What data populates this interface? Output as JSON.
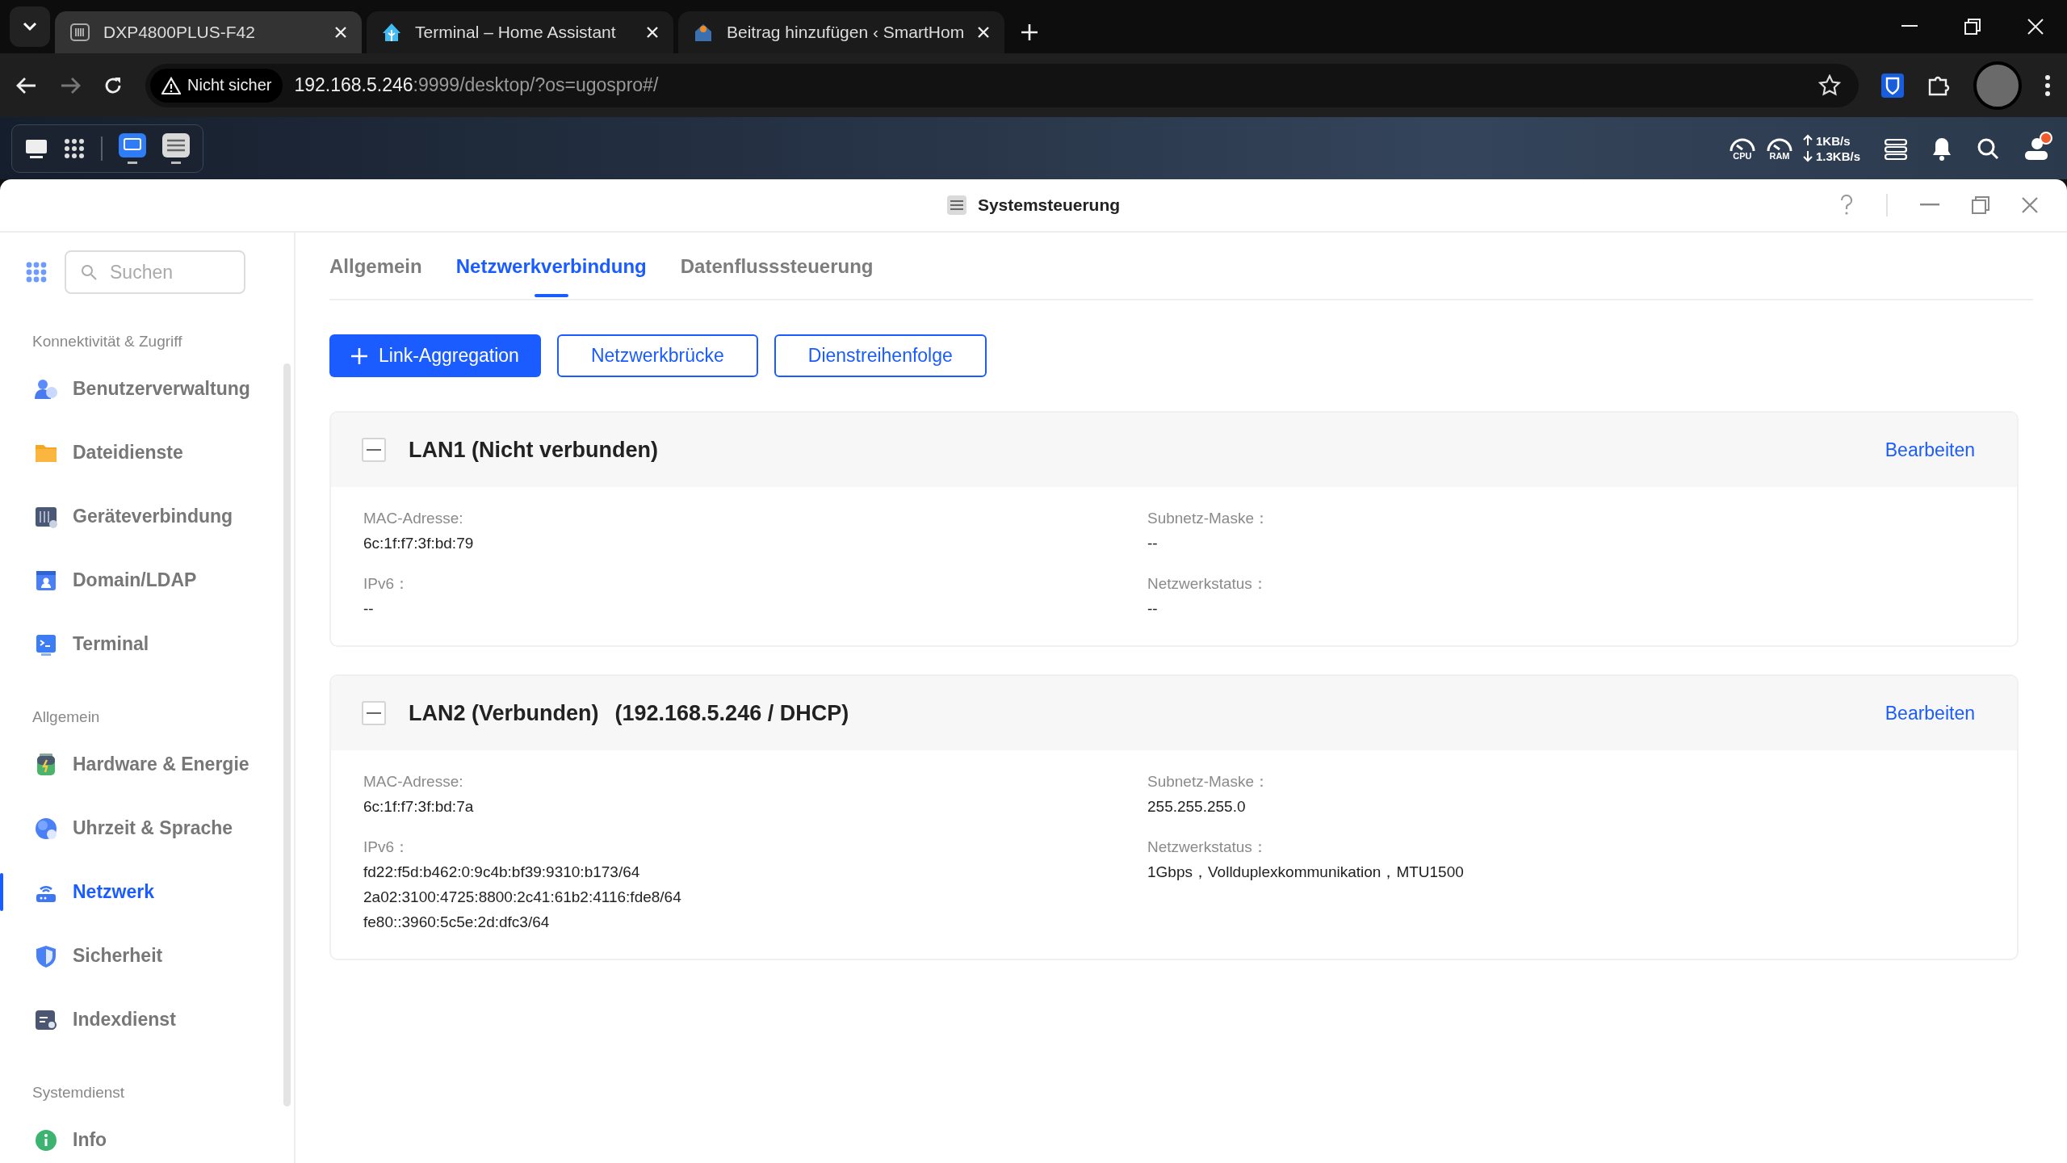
{
  "browser": {
    "tabs": [
      {
        "title": "DXP4800PLUS-F42",
        "selected": true
      },
      {
        "title": "Terminal – Home Assistant",
        "selected": false
      },
      {
        "title": "Beitrag hinzufügen ‹ SmartHom",
        "selected": false
      }
    ],
    "security": "Nicht sicher",
    "url_host": "192.168.5.246",
    "url_rest": ":9999/desktop/?os=ugospro#/"
  },
  "desktop_bar": {
    "cpu": "CPU",
    "ram": "RAM",
    "upload": "1KB/s",
    "download": "1.3KB/s",
    "notification": true
  },
  "window": {
    "title": "Systemsteuerung"
  },
  "sidebar": {
    "search": {
      "placeholder": "Suchen"
    },
    "groups": [
      {
        "title": "Konnektivität & Zugriff",
        "items": [
          {
            "label": "Benutzerverwaltung",
            "selected": false
          },
          {
            "label": "Dateidienste",
            "selected": false
          },
          {
            "label": "Geräteverbindung",
            "selected": false
          },
          {
            "label": "Domain/LDAP",
            "selected": false
          },
          {
            "label": "Terminal",
            "selected": false
          }
        ]
      },
      {
        "title": "Allgemein",
        "items": [
          {
            "label": "Hardware & Energie",
            "selected": false
          },
          {
            "label": "Uhrzeit & Sprache",
            "selected": false
          },
          {
            "label": "Netzwerk",
            "selected": true
          },
          {
            "label": "Sicherheit",
            "selected": false
          },
          {
            "label": "Indexdienst",
            "selected": false
          }
        ]
      },
      {
        "title": "Systemdienst",
        "items": [
          {
            "label": "Info",
            "selected": false
          }
        ]
      }
    ]
  },
  "tabs": [
    {
      "label": "Allgemein",
      "selected": false
    },
    {
      "label": "Netzwerkverbindung",
      "selected": true
    },
    {
      "label": "Datenflusssteuerung",
      "selected": false
    }
  ],
  "actions": [
    {
      "label": "Link-Aggregation",
      "kind": "primary"
    },
    {
      "label": "Netzwerkbrücke",
      "kind": "outline"
    },
    {
      "label": "Dienstreihenfolge",
      "kind": "outline"
    }
  ],
  "interfaces": [
    {
      "title": "LAN1 (Nicht verbunden)",
      "expanded": true,
      "action": "Bearbeiten",
      "fields": [
        {
          "label": "MAC-Adresse:",
          "values": [
            "6c:1f:f7:3f:bd:79"
          ]
        },
        {
          "label": "Subnetz-Maske：",
          "values": [
            "--"
          ]
        },
        {
          "label": "IPv6：",
          "values": [
            "--"
          ]
        },
        {
          "label": "Netzwerkstatus：",
          "values": [
            "--"
          ]
        }
      ]
    },
    {
      "title": "LAN2 (Verbunden)",
      "address": "(192.168.5.246 / DHCP)",
      "expanded": true,
      "action": "Bearbeiten",
      "fields": [
        {
          "label": "MAC-Adresse:",
          "values": [
            "6c:1f:f7:3f:bd:7a"
          ]
        },
        {
          "label": "Subnetz-Maske：",
          "values": [
            "255.255.255.0"
          ]
        },
        {
          "label": "IPv6：",
          "values": [
            "fd22:f5d:b462:0:9c4b:bf39:9310:b173/64",
            "2a02:3100:4725:8800:2c41:61b2:4116:fde8/64",
            "fe80::3960:5c5e:2d:dfc3/64"
          ]
        },
        {
          "label": "Netzwerkstatus：",
          "values": [
            "1Gbps，Vollduplexkommunikation，MTU1500"
          ]
        }
      ]
    }
  ]
}
